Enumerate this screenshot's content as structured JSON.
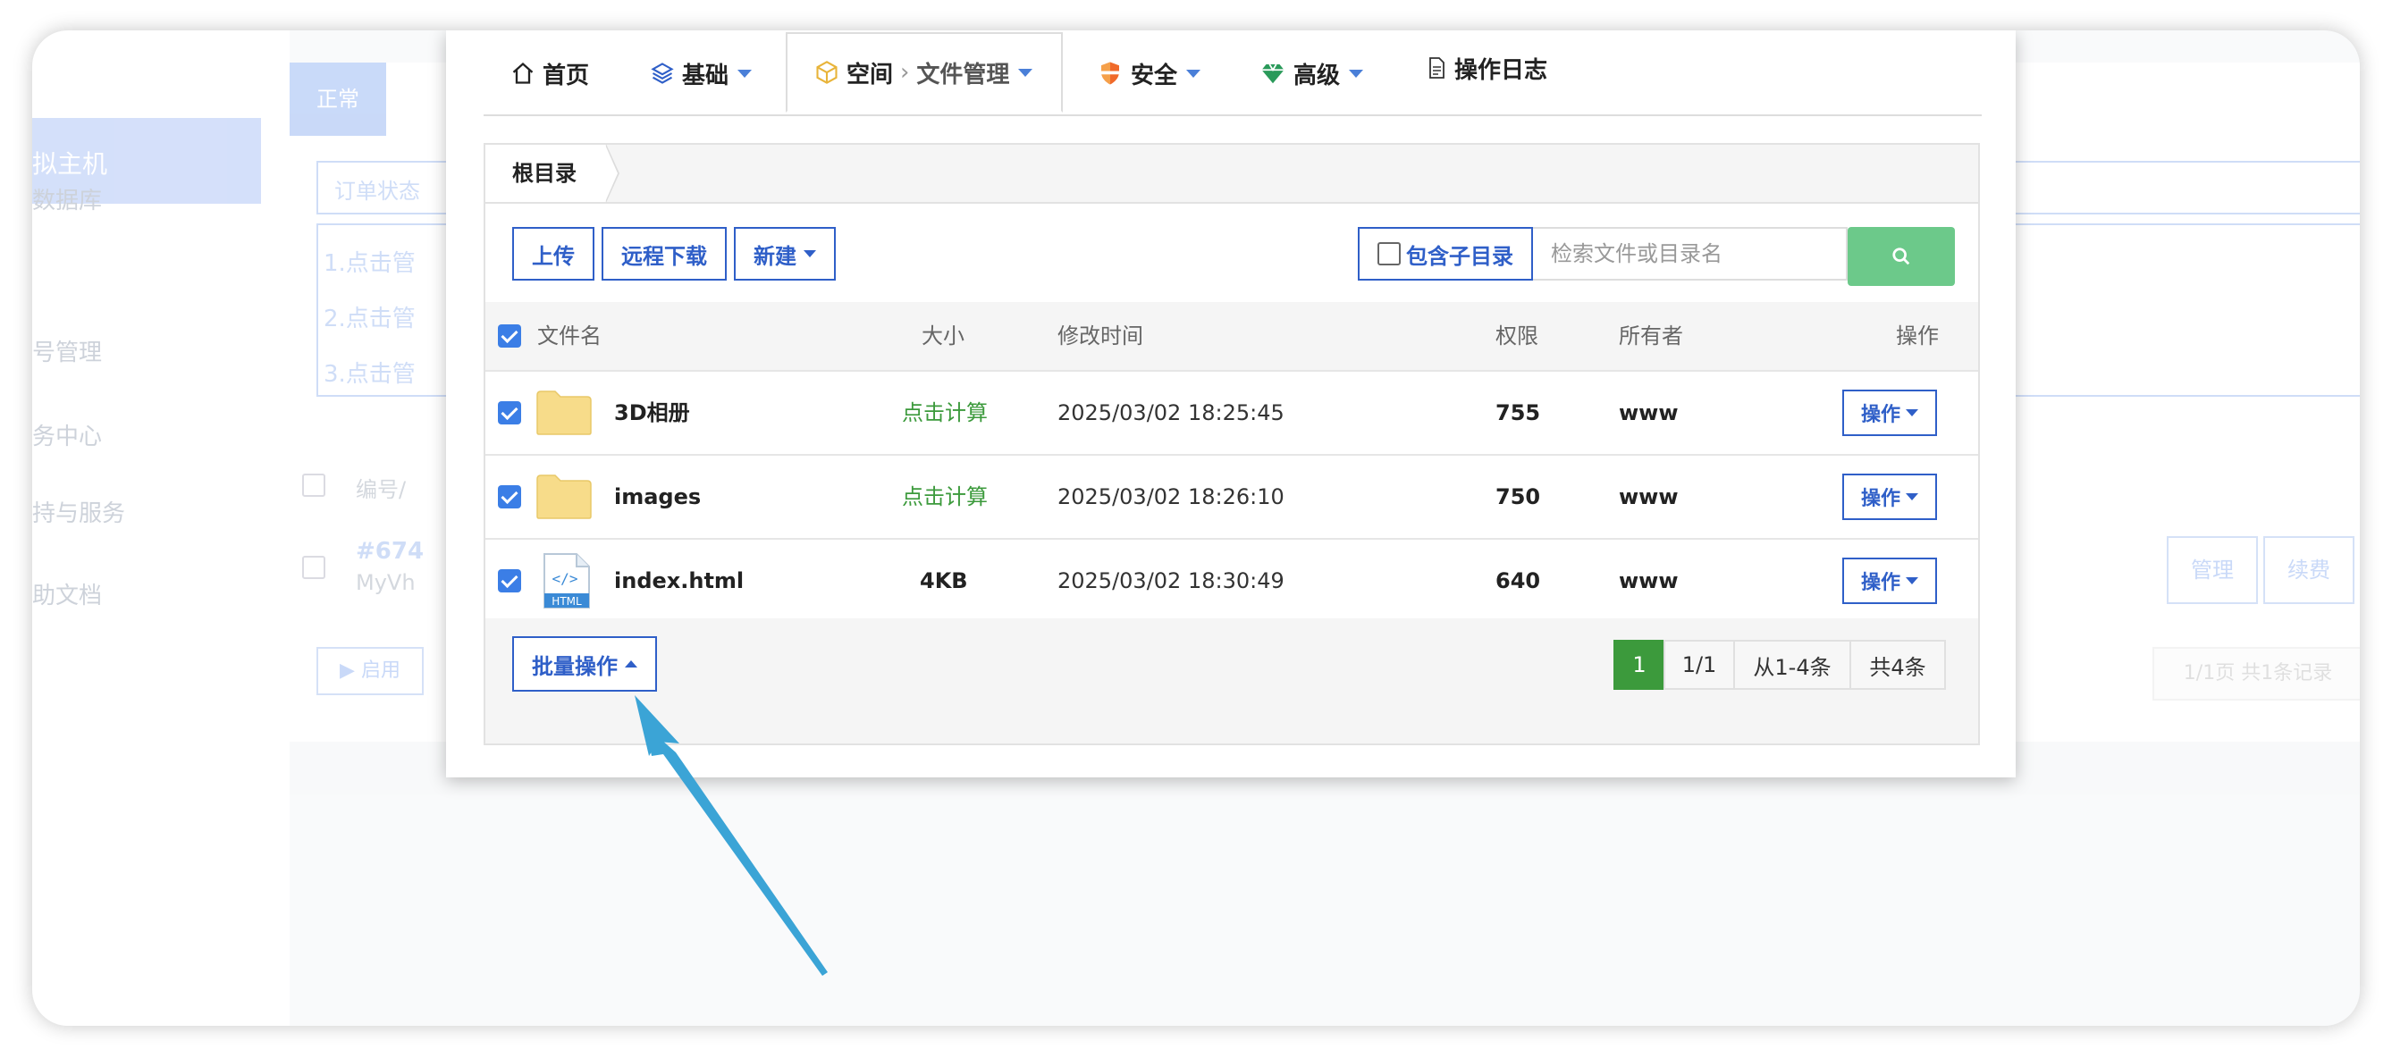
{
  "background": {
    "sidebar": {
      "active_label": "拟主机",
      "items": [
        "数据库",
        "号管理",
        "务中心",
        "持与服务",
        "助文档"
      ]
    },
    "status_tab": "正常",
    "filter_label": "订单状态",
    "notes": [
      "1.点击管",
      "2.点击管",
      "3.点击管"
    ],
    "table_header": "编号/",
    "order_id": "#674",
    "order_name": "MyVh",
    "enable_button": "▶ 启用",
    "manage_button": "管理",
    "renew_button": "续费",
    "paging": "1/1页 共1条记录"
  },
  "tabs": [
    {
      "label": "首页",
      "icon": "home-icon"
    },
    {
      "label": "基础",
      "icon": "layers-icon"
    },
    {
      "label": "空间",
      "sub": "文件管理",
      "icon": "cube-icon"
    },
    {
      "label": "安全",
      "icon": "shield-icon"
    },
    {
      "label": "高级",
      "icon": "gem-icon"
    },
    {
      "label": "操作日志",
      "icon": "document-icon"
    }
  ],
  "breadcrumb": "根目录",
  "toolbar": {
    "upload": "上传",
    "remote_download": "远程下载",
    "new": "新建",
    "include_subdir": "包含子目录",
    "search_placeholder": "检索文件或目录名"
  },
  "table": {
    "columns": {
      "name": "文件名",
      "size": "大小",
      "mtime": "修改时间",
      "perm": "权限",
      "owner": "所有者",
      "action": "操作"
    },
    "rows": [
      {
        "name": "3D相册",
        "type": "folder",
        "size": "点击计算",
        "mtime": "2025/03/02 18:25:45",
        "perm": "755",
        "owner": "www",
        "action": "操作"
      },
      {
        "name": "images",
        "type": "folder",
        "size": "点击计算",
        "mtime": "2025/03/02 18:26:10",
        "perm": "750",
        "owner": "www",
        "action": "操作"
      },
      {
        "name": "index.html",
        "type": "html",
        "size": "4KB",
        "mtime": "2025/03/02 18:30:49",
        "perm": "640",
        "owner": "www",
        "action": "操作"
      }
    ]
  },
  "footer": {
    "batch": "批量操作",
    "pager": {
      "current": "1",
      "pages": "1/1",
      "range": "从1-4条",
      "total": "共4条"
    }
  },
  "html_badge": "HTML",
  "colors": {
    "accent": "#2f5fc8",
    "search": "#6cc98a",
    "page_current": "#3c9a3c",
    "arrow": "#3ba4d6"
  }
}
